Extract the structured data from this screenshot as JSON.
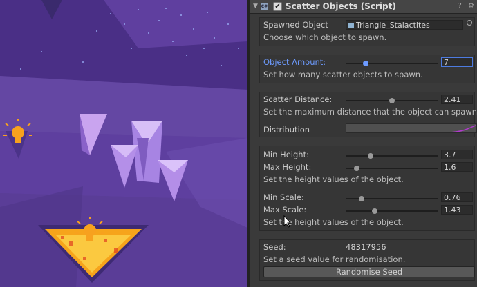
{
  "component": {
    "title": "Scatter Objects (Script)",
    "enabled": true
  },
  "spawned_object": {
    "label": "Spawned Object",
    "value": "Triangle_Stalactites",
    "description": "Choose which object to spawn."
  },
  "object_amount": {
    "label": "Object Amount:",
    "value": "7",
    "slider_fraction": 0.22,
    "description": "Set how many scatter objects to spawn."
  },
  "scatter_distance": {
    "label": "Scatter Distance:",
    "value": "2.41",
    "slider_fraction": 0.5,
    "description": "Set the maximum distance that the object can spawn"
  },
  "distribution": {
    "label": "Distribution"
  },
  "heights": {
    "min_label": "Min Height:",
    "min_value": "3.7",
    "min_fraction": 0.27,
    "max_label": "Max Height:",
    "max_value": "1.6",
    "max_fraction": 0.12,
    "description": "Set the height values of the object."
  },
  "scales": {
    "min_label": "Min Scale:",
    "min_value": "0.76",
    "min_fraction": 0.17,
    "max_label": "Max Scale:",
    "max_value": "1.43",
    "max_fraction": 0.31,
    "description": "Set the height values of the object."
  },
  "seed": {
    "label": "Seed:",
    "value": "48317956",
    "description": "Set a seed value for randomisation.",
    "button": "Randomise Seed"
  },
  "colors": {
    "highlight": "#6d9bff",
    "curve": "#b03acb",
    "scene_bg": "#5a3f99",
    "light": "#f7a11e"
  },
  "icons": [
    "script-icon",
    "help-icon",
    "settings-icon",
    "target-icon",
    "light-icon"
  ]
}
